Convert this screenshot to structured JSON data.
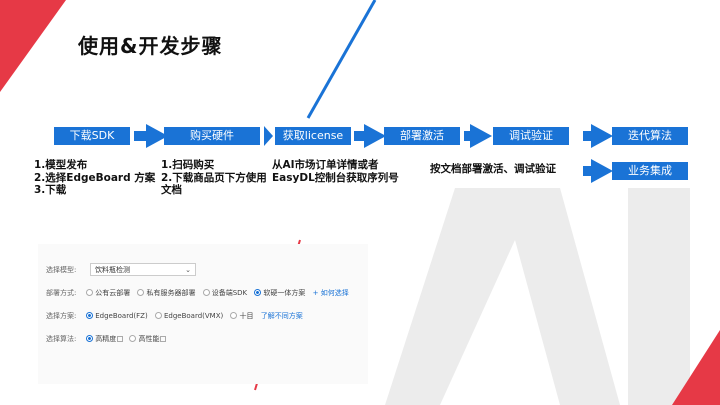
{
  "title": "使用&开发步骤",
  "steps": [
    {
      "label": "下载SDK"
    },
    {
      "label": "购买硬件"
    },
    {
      "label": "获取license"
    },
    {
      "label": "部署激活"
    },
    {
      "label": "调试验证"
    },
    {
      "label": "迭代算法"
    },
    {
      "label": "业务集成"
    }
  ],
  "descriptions": {
    "sdk": [
      "1.模型发布",
      "2.选择EdgeBoard 方案",
      "3.下载"
    ],
    "hardware": [
      "1.扫码购买",
      "2.下载商品页下方使用",
      "文档"
    ],
    "license": [
      "从AI市场订单详情或者",
      "EasyDL控制台获取序列号"
    ],
    "deploy": "按文档部署激活、调试验证"
  },
  "form": {
    "model_label": "选择模型:",
    "model_value": "饮料瓶检测",
    "deploy_label": "部署方式:",
    "deploy_options": [
      "公有云部署",
      "私有服务器部署",
      "设备端SDK",
      "软硬一体方案"
    ],
    "deploy_link": "+ 如何选择",
    "plan_label": "选择方案:",
    "plan_options": [
      "EdgeBoard(FZ)",
      "EdgeBoard(VMX)",
      "十目"
    ],
    "plan_link": "了解不同方案",
    "algo_label": "选择算法:",
    "algo_options": [
      "高精度",
      "高性能"
    ]
  },
  "colors": {
    "accent": "#1a73d6",
    "red": "#e63946",
    "gray": "#e6e6e6"
  }
}
